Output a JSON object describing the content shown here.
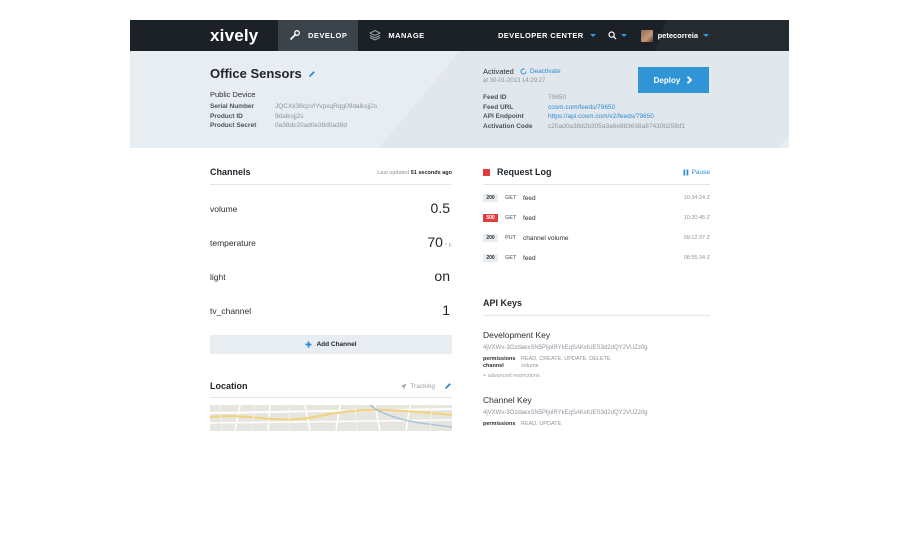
{
  "nav": {
    "logo": "xively",
    "tabs": [
      {
        "label": "DEVELOP",
        "icon": "wrench-icon"
      },
      {
        "label": "MANAGE",
        "icon": "layers-icon"
      }
    ],
    "developer_center": "DEVELOPER CENTER",
    "username": "petecorreia"
  },
  "device": {
    "title": "Office Sensors",
    "type": "Public Device",
    "fields": [
      {
        "label": "Serial Number",
        "value": "JQCXk38cpVlYvpxqRqg09dalksjj2s"
      },
      {
        "label": "Product ID",
        "value": "9dalksjj2s"
      },
      {
        "label": "Product Secret",
        "value": "0a38dc20ad0e38d0a38d"
      }
    ],
    "activated_label": "Activated",
    "deactivate_label": "Deactivate",
    "activated_at": "at 30-01-2013 14:29:27",
    "feed": [
      {
        "label": "Feed ID",
        "value": "79650",
        "link": false
      },
      {
        "label": "Feed URL",
        "value": "cosm.com/feeds/79650",
        "link": true
      },
      {
        "label": "API Endpoint",
        "value": "https://api.cosm.com/v2/feeds/79650",
        "link": true
      },
      {
        "label": "Activation Code",
        "value": "c20ad0a38d2b305a3a6e983638a87430b25fbf1",
        "link": false
      }
    ],
    "deploy_label": "Deploy"
  },
  "channels": {
    "title": "Channels",
    "last_updated_prefix": "Last updated",
    "last_updated_value": "51 seconds ago",
    "items": [
      {
        "name": "volume",
        "value": "0.5",
        "unit": ""
      },
      {
        "name": "temperature",
        "value": "70",
        "unit": "° F"
      },
      {
        "name": "light",
        "value": "on",
        "unit": ""
      },
      {
        "name": "tv_channel",
        "value": "1",
        "unit": ""
      }
    ],
    "add_label": "Add Channel"
  },
  "location": {
    "title": "Location",
    "tracking_label": "Tracking"
  },
  "request_log": {
    "title": "Request Log",
    "pause_label": "Pause",
    "entries": [
      {
        "status": "200",
        "method": "GET",
        "path": "feed",
        "time": "10:34:24 Z"
      },
      {
        "status": "500",
        "method": "GET",
        "path": "feed",
        "time": "10:30:45 Z"
      },
      {
        "status": "200",
        "method": "PUT",
        "path": "channel volume",
        "time": "09:12:37 Z"
      },
      {
        "status": "200",
        "method": "GET",
        "path": "feed",
        "time": "08:55:34 Z"
      }
    ]
  },
  "api_keys": {
    "title": "API Keys",
    "keys": [
      {
        "name": "Development Key",
        "key": "4jVXWv-3OzdaexSN5PljolRYkEqSAKxlUES3d2dQY2VUZz0g",
        "permissions_label": "permissions",
        "permissions": "READ, CREATE, UPDATE, DELETE",
        "channel_label": "channel",
        "channel": "volume",
        "advanced": "+ advanced restrictions"
      },
      {
        "name": "Channel Key",
        "key": "4jVXWv-3OzdaexSN5PljolRYkEqSAKxlUES3d2dQY2VUZz0g",
        "permissions_label": "permissions",
        "permissions": "READ, UPDATE"
      }
    ]
  },
  "colors": {
    "nav_bg": "#1c2127",
    "accent": "#2f95d7",
    "error": "#e03e3e",
    "header_bg": "#e8edf1"
  }
}
